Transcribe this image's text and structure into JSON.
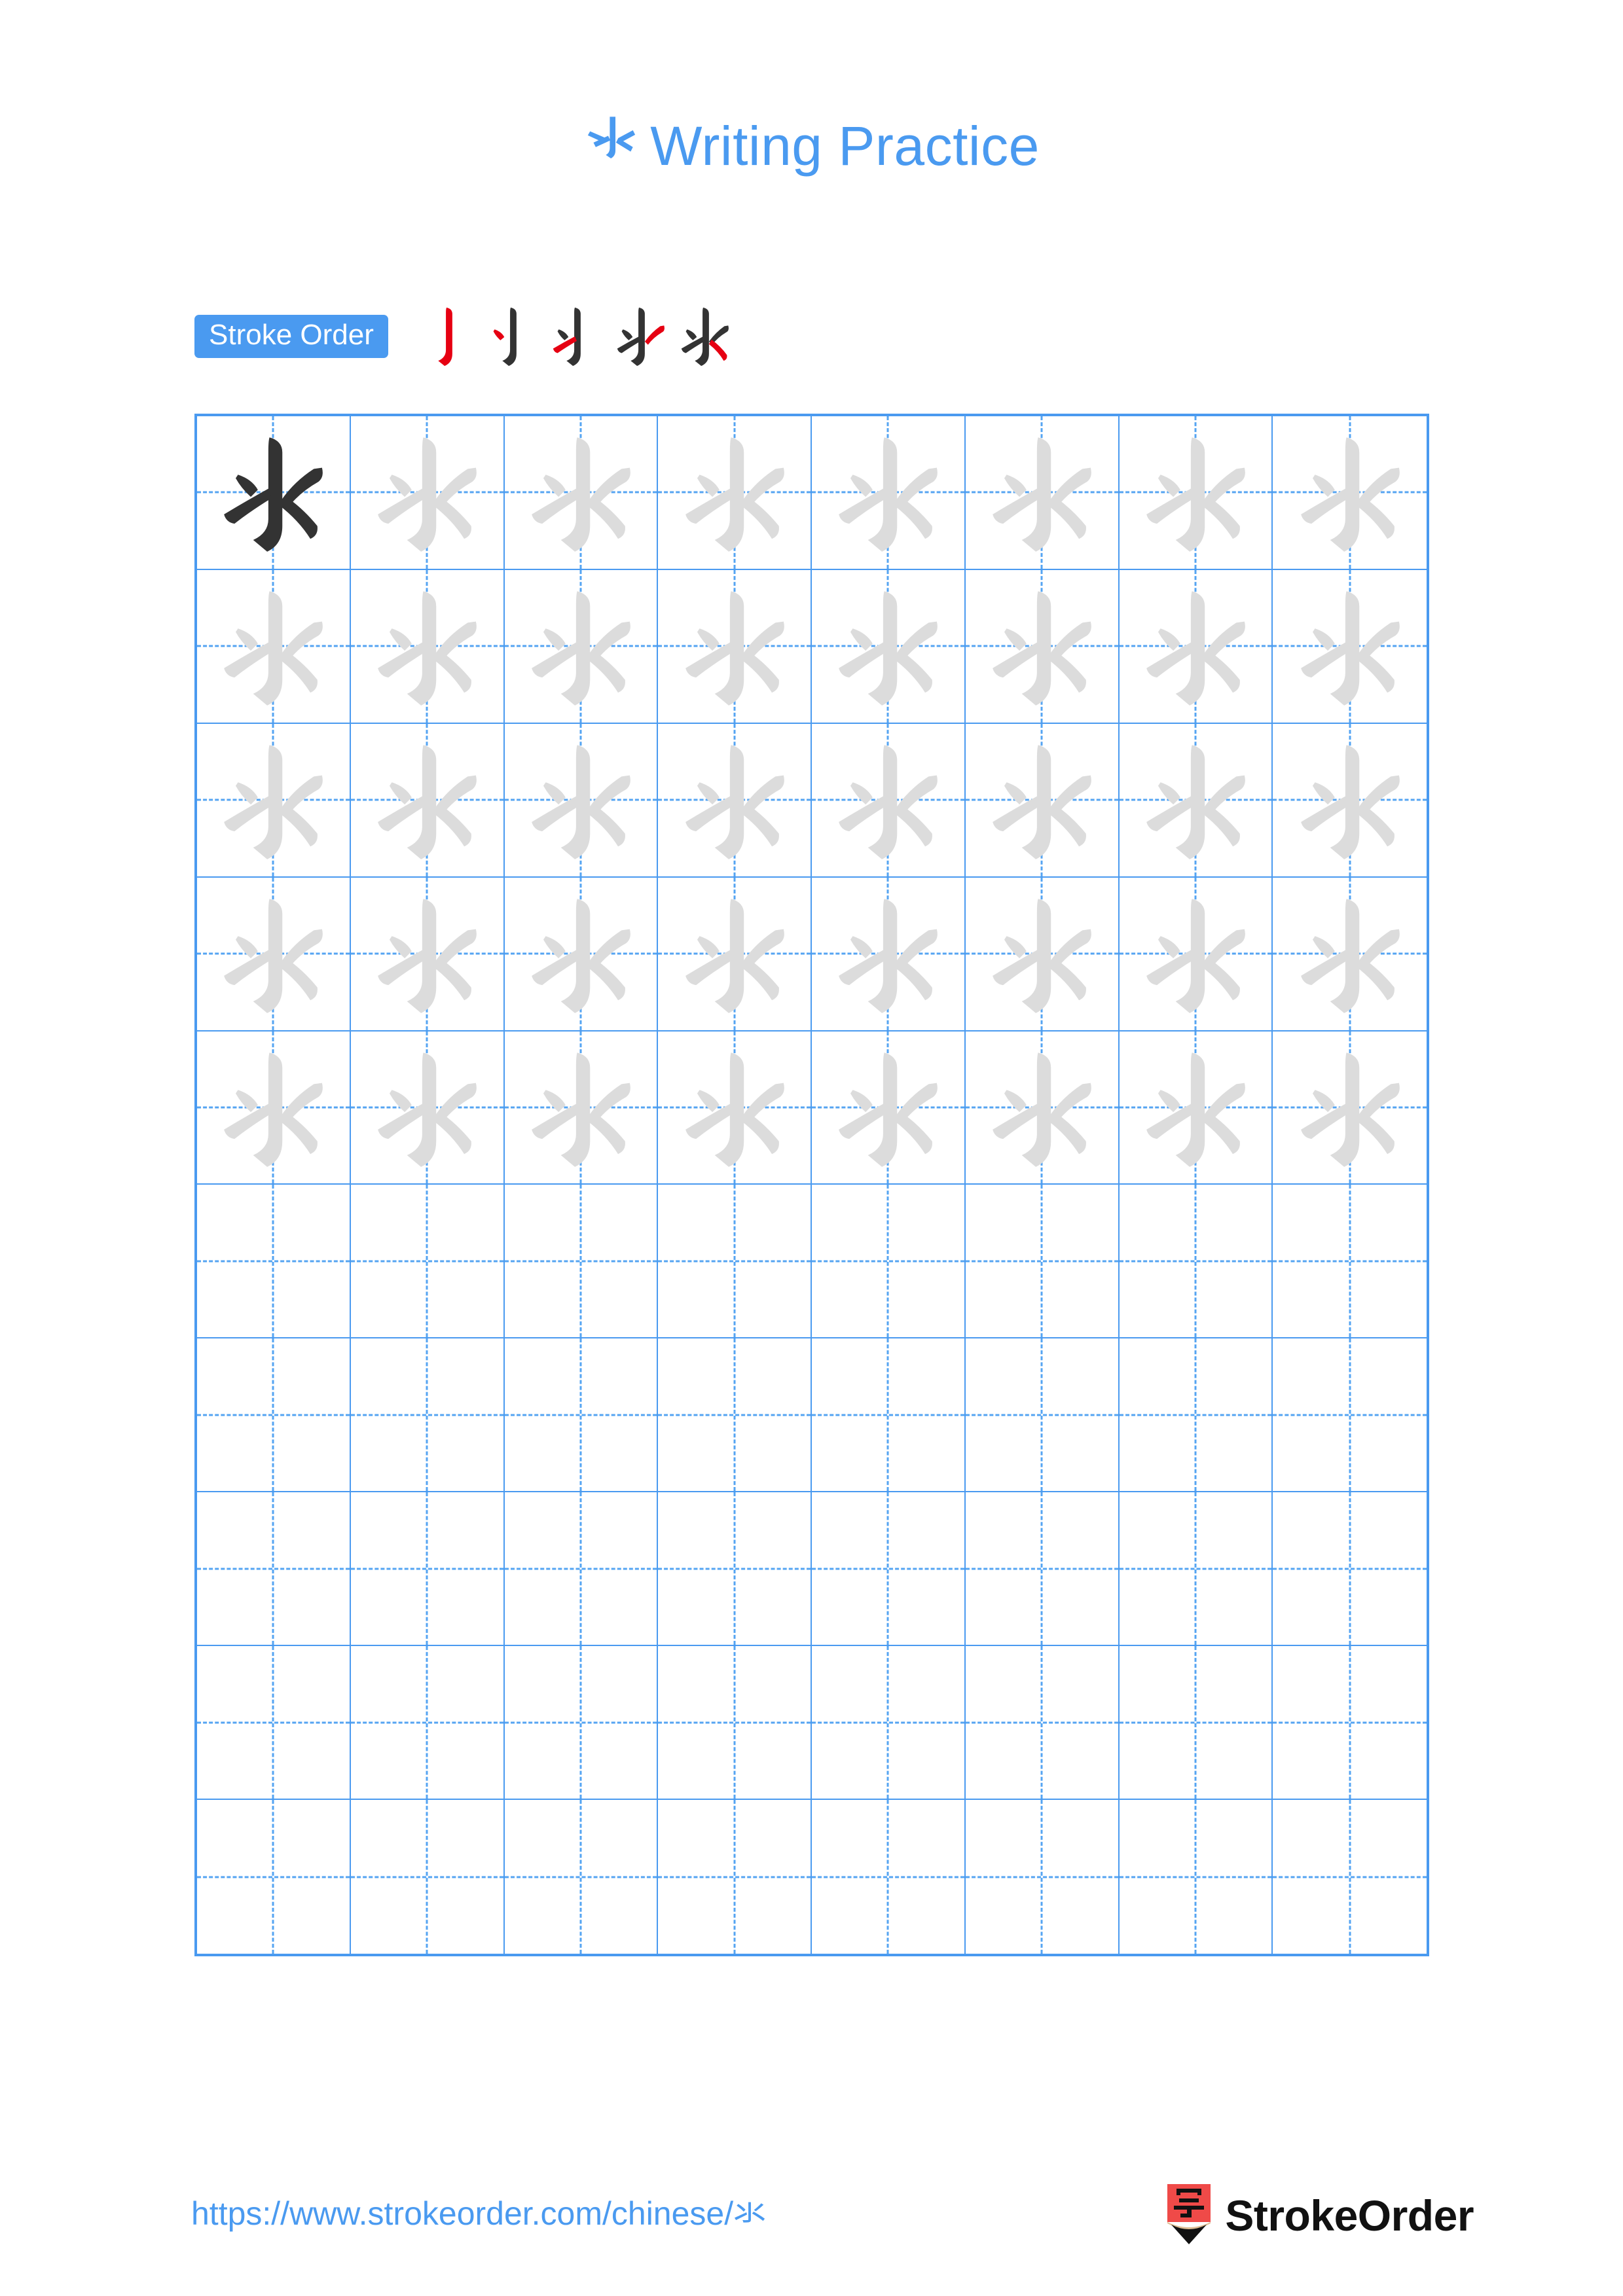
{
  "document": {
    "character": "氺",
    "title_suffix": "Writing Practice",
    "title_full": "氺 Writing Practice",
    "accent_color": "#4a9af0",
    "trace_color": "#dcdcdc",
    "ink_color": "#333333",
    "stroke_highlight_color": "#e60012",
    "page_background": "#ffffff"
  },
  "stroke_order": {
    "badge_label": "Stroke Order",
    "stroke_count": 5,
    "steps": [
      {
        "index": 1,
        "new_stroke": "vertical-hook",
        "strokes_shown": 1
      },
      {
        "index": 2,
        "new_stroke": "left-dot",
        "strokes_shown": 2
      },
      {
        "index": 3,
        "new_stroke": "left-rising",
        "strokes_shown": 3
      },
      {
        "index": 4,
        "new_stroke": "right-dot",
        "strokes_shown": 4
      },
      {
        "index": 5,
        "new_stroke": "right-falling",
        "strokes_shown": 5
      }
    ]
  },
  "practice_grid": {
    "columns": 8,
    "rows": 10,
    "guide_style": "dashed-cross",
    "rows_data": [
      [
        "ink",
        "trace",
        "trace",
        "trace",
        "trace",
        "trace",
        "trace",
        "trace"
      ],
      [
        "trace",
        "trace",
        "trace",
        "trace",
        "trace",
        "trace",
        "trace",
        "trace"
      ],
      [
        "trace",
        "trace",
        "trace",
        "trace",
        "trace",
        "trace",
        "trace",
        "trace"
      ],
      [
        "trace",
        "trace",
        "trace",
        "trace",
        "trace",
        "trace",
        "trace",
        "trace"
      ],
      [
        "trace",
        "trace",
        "trace",
        "trace",
        "trace",
        "trace",
        "trace",
        "trace"
      ],
      [
        "empty",
        "empty",
        "empty",
        "empty",
        "empty",
        "empty",
        "empty",
        "empty"
      ],
      [
        "empty",
        "empty",
        "empty",
        "empty",
        "empty",
        "empty",
        "empty",
        "empty"
      ],
      [
        "empty",
        "empty",
        "empty",
        "empty",
        "empty",
        "empty",
        "empty",
        "empty"
      ],
      [
        "empty",
        "empty",
        "empty",
        "empty",
        "empty",
        "empty",
        "empty",
        "empty"
      ],
      [
        "empty",
        "empty",
        "empty",
        "empty",
        "empty",
        "empty",
        "empty",
        "empty"
      ]
    ]
  },
  "footer": {
    "url": "https://www.strokeorder.com/chinese/氺",
    "brand_name": "StrokeOrder",
    "logo_character": "字",
    "logo_body_color": "#ef4a48",
    "logo_wood_color": "#debd93",
    "logo_tip_color": "#111111"
  }
}
